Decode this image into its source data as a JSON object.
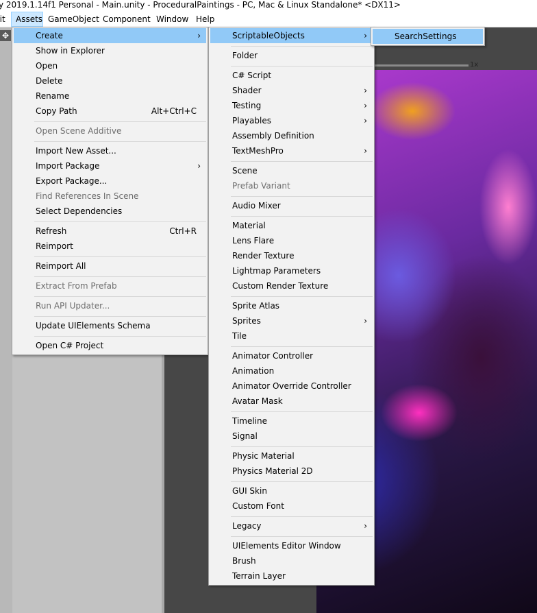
{
  "window": {
    "title": "y 2019.1.14f1 Personal - Main.unity - ProceduralPaintings - PC, Mac & Linux Standalone* <DX11>"
  },
  "menubar": {
    "items": [
      {
        "label": "dit"
      },
      {
        "label": "Assets"
      },
      {
        "label": "GameObject"
      },
      {
        "label": "Component"
      },
      {
        "label": "Window"
      },
      {
        "label": "Help"
      }
    ]
  },
  "scene": {
    "zoom_label": "1x"
  },
  "assets_menu": {
    "items": [
      {
        "label": "Create",
        "submenu": true,
        "highlighted": true
      },
      {
        "label": "Show in Explorer"
      },
      {
        "label": "Open"
      },
      {
        "label": "Delete"
      },
      {
        "label": "Rename"
      },
      {
        "label": "Copy Path",
        "shortcut": "Alt+Ctrl+C"
      },
      {
        "label": "Open Scene Additive",
        "disabled": true
      },
      {
        "label": "Import New Asset..."
      },
      {
        "label": "Import Package",
        "submenu": true
      },
      {
        "label": "Export Package..."
      },
      {
        "label": "Find References In Scene",
        "disabled": true
      },
      {
        "label": "Select Dependencies"
      },
      {
        "label": "Refresh",
        "shortcut": "Ctrl+R"
      },
      {
        "label": "Reimport"
      },
      {
        "label": "Reimport All"
      },
      {
        "label": "Extract From Prefab",
        "disabled": true
      },
      {
        "label": "Run API Updater...",
        "disabled": true
      },
      {
        "label": "Update UIElements Schema"
      },
      {
        "label": "Open C# Project"
      }
    ]
  },
  "create_menu": {
    "items": [
      {
        "label": "ScriptableObjects",
        "submenu": true,
        "highlighted": true
      },
      {
        "label": "Folder"
      },
      {
        "label": "C# Script"
      },
      {
        "label": "Shader",
        "submenu": true
      },
      {
        "label": "Testing",
        "submenu": true
      },
      {
        "label": "Playables",
        "submenu": true
      },
      {
        "label": "Assembly Definition"
      },
      {
        "label": "TextMeshPro",
        "submenu": true
      },
      {
        "label": "Scene"
      },
      {
        "label": "Prefab Variant",
        "disabled": true
      },
      {
        "label": "Audio Mixer"
      },
      {
        "label": "Material"
      },
      {
        "label": "Lens Flare"
      },
      {
        "label": "Render Texture"
      },
      {
        "label": "Lightmap Parameters"
      },
      {
        "label": "Custom Render Texture"
      },
      {
        "label": "Sprite Atlas"
      },
      {
        "label": "Sprites",
        "submenu": true
      },
      {
        "label": "Tile"
      },
      {
        "label": "Animator Controller"
      },
      {
        "label": "Animation"
      },
      {
        "label": "Animator Override Controller"
      },
      {
        "label": "Avatar Mask"
      },
      {
        "label": "Timeline"
      },
      {
        "label": "Signal"
      },
      {
        "label": "Physic Material"
      },
      {
        "label": "Physics Material 2D"
      },
      {
        "label": "GUI Skin"
      },
      {
        "label": "Custom Font"
      },
      {
        "label": "Legacy",
        "submenu": true
      },
      {
        "label": "UIElements Editor Window"
      },
      {
        "label": "Brush"
      },
      {
        "label": "Terrain Layer"
      }
    ]
  },
  "scriptable_menu": {
    "items": [
      {
        "label": "SearchSettings",
        "highlighted": true
      }
    ]
  },
  "glyphs": {
    "submenu_arrow": "›",
    "move_tool": "✥"
  }
}
